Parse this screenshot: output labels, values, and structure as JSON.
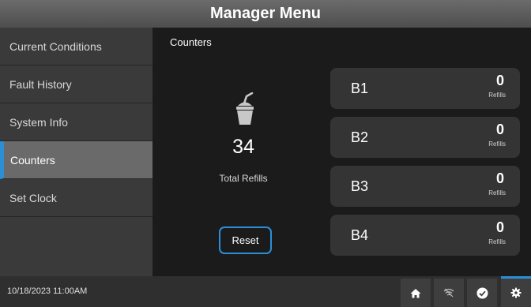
{
  "header": {
    "title": "Manager Menu"
  },
  "sidebar": {
    "items": [
      {
        "label": "Current Conditions"
      },
      {
        "label": "Fault History"
      },
      {
        "label": "System Info"
      },
      {
        "label": "Counters"
      },
      {
        "label": "Set Clock"
      }
    ],
    "active": "Counters"
  },
  "main": {
    "title": "Counters",
    "total_count": "34",
    "total_label": "Total Refills",
    "reset_label": "Reset",
    "icon": "cup-icon",
    "bins": [
      {
        "name": "B1",
        "count": "0",
        "unit": "Refills"
      },
      {
        "name": "B2",
        "count": "0",
        "unit": "Refills"
      },
      {
        "name": "B3",
        "count": "0",
        "unit": "Refills"
      },
      {
        "name": "B4",
        "count": "0",
        "unit": "Refills"
      }
    ]
  },
  "footer": {
    "datetime": "10/18/2023 11:00AM",
    "icons": [
      "home-icon",
      "wifi-off-icon",
      "check-icon",
      "gear-icon"
    ],
    "active_icon": "gear-icon"
  },
  "colors": {
    "accent": "#2b8fd6",
    "header": "#5a5a5a",
    "sidebar": "#3a3a3a",
    "active_item": "#6a6a6a",
    "card": "#343434"
  }
}
